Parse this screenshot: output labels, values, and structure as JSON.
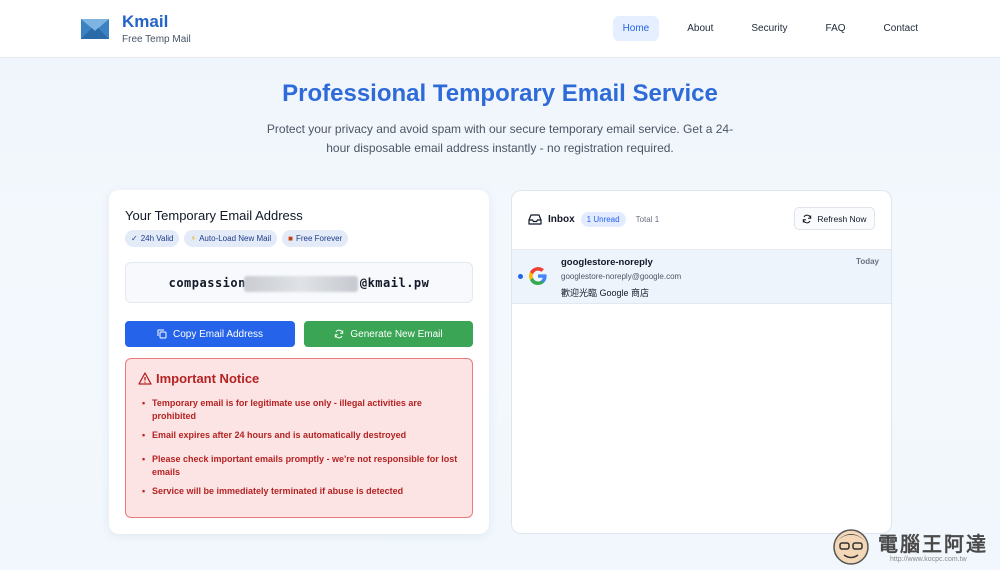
{
  "header": {
    "logo_title": "Kmail",
    "logo_subtitle": "Free Temp Mail",
    "nav": [
      {
        "label": "Home",
        "active": true
      },
      {
        "label": "About",
        "active": false
      },
      {
        "label": "Security",
        "active": false
      },
      {
        "label": "FAQ",
        "active": false
      },
      {
        "label": "Contact",
        "active": false
      }
    ]
  },
  "hero": {
    "title": "Professional Temporary Email Service",
    "description": "Protect your privacy and avoid spam with our secure temporary email service. Get a 24-hour disposable email address instantly - no registration required."
  },
  "email_card": {
    "title": "Your Temporary Email Address",
    "badges": [
      "24h Valid",
      "Auto-Load New Mail",
      "Free Forever"
    ],
    "email_prefix": "compassion",
    "email_suffix": "@kmail.pw",
    "copy_button": "Copy Email Address",
    "generate_button": "Generate New Email",
    "notice_title": "Important Notice",
    "notice_items": [
      "Temporary email is for legitimate use only - illegal activities are prohibited",
      "Email expires after 24 hours and is automatically destroyed",
      "Please check important emails promptly - we're not responsible for lost emails",
      "Service will be immediately terminated if abuse is detected"
    ]
  },
  "inbox": {
    "label": "Inbox",
    "unread_badge": "1 Unread",
    "total": "Total 1",
    "refresh_button": "Refresh Now",
    "messages": [
      {
        "sender": "googlestore-noreply",
        "address": "googlestore-noreply@google.com",
        "subject": "歡迎光臨 Google 商店",
        "time": "Today",
        "unread": true
      }
    ]
  },
  "watermark": {
    "text": "電腦王阿達",
    "url": "http://www.kocpc.com.tw"
  },
  "colors": {
    "brand": "#2563c9",
    "primary_button": "#2563eb",
    "success_button": "#3aa655",
    "notice_bg": "#fde4e4",
    "notice_text": "#b42323"
  }
}
